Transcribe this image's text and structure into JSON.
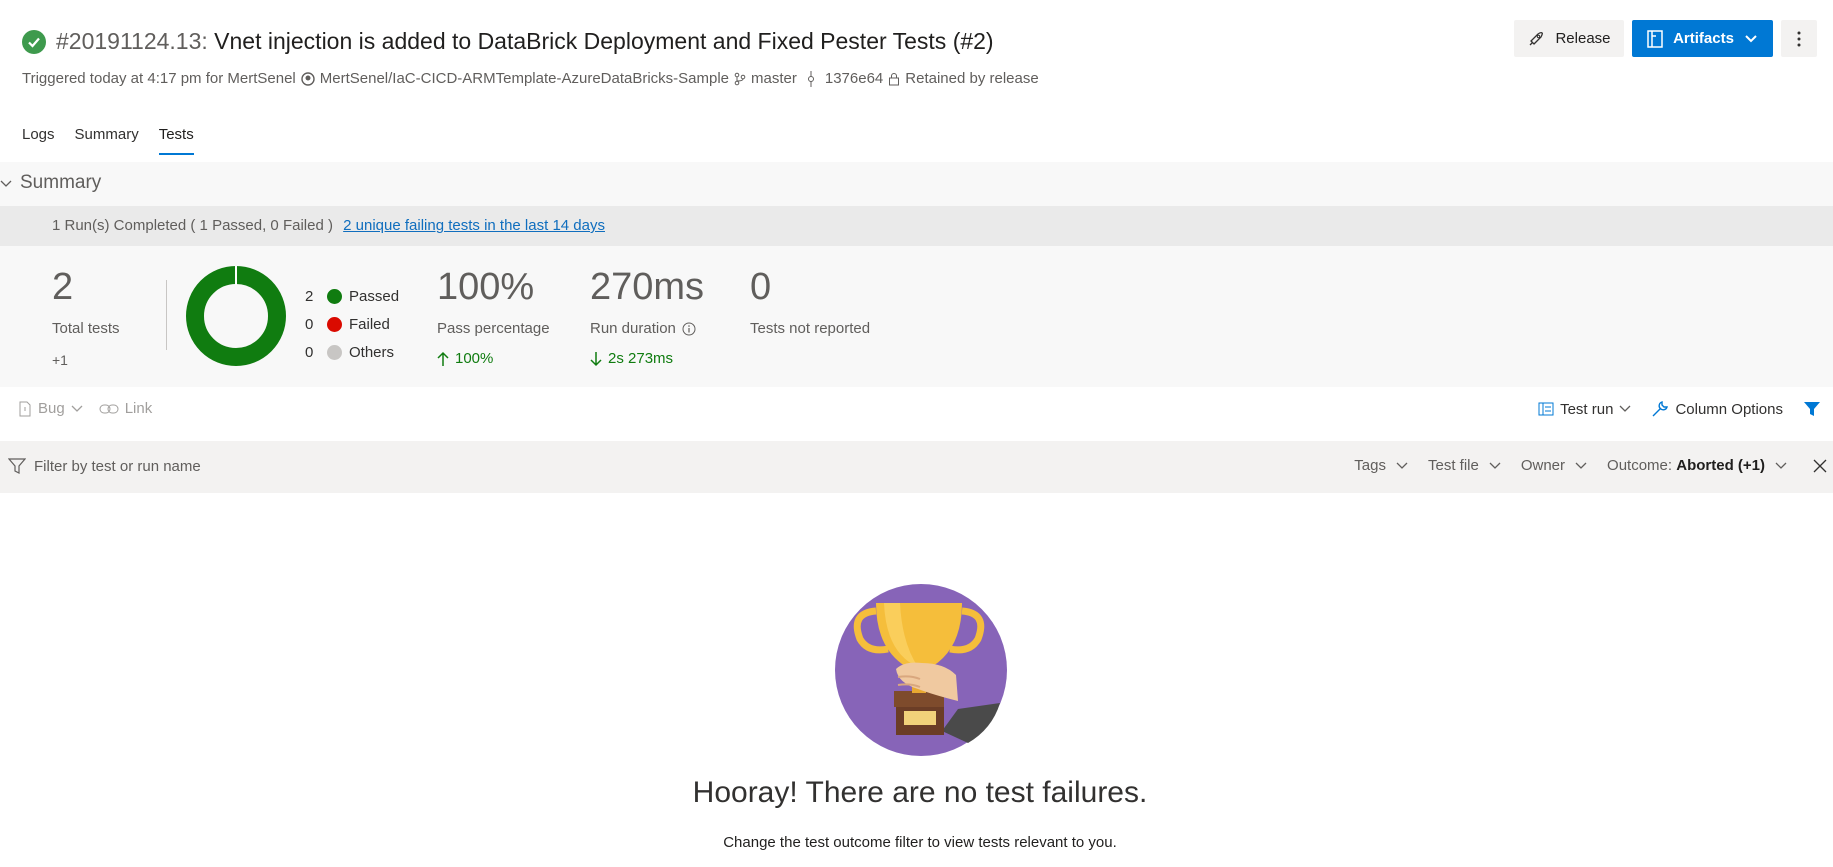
{
  "header": {
    "build_number": "#20191124.13:",
    "title": "Vnet injection is added to DataBrick Deployment and Fixed Pester Tests (#2)",
    "triggered": "Triggered today at 4:17 pm for MertSenel",
    "repo": "MertSenel/IaC-CICD-ARMTemplate-AzureDataBricks-Sample",
    "branch": "master",
    "commit": "1376e64",
    "retained": "Retained by release",
    "release_label": "Release",
    "artifacts_label": "Artifacts"
  },
  "tabs": [
    {
      "label": "Logs"
    },
    {
      "label": "Summary"
    },
    {
      "label": "Tests"
    }
  ],
  "summary": {
    "section_title": "Summary",
    "run_text": "1 Run(s) Completed ( 1 Passed, 0 Failed )",
    "run_link": "2 unique failing tests in the last 14 days",
    "total_tests": "2",
    "total_label": "Total tests",
    "total_delta": "+1",
    "legend": [
      {
        "count": "2",
        "label": "Passed",
        "color": "#107c10"
      },
      {
        "count": "0",
        "label": "Failed",
        "color": "#da0a00"
      },
      {
        "count": "0",
        "label": "Others",
        "color": "#c8c6c4"
      }
    ],
    "pass_pct": "100%",
    "pass_label": "Pass percentage",
    "pass_delta": "100%",
    "duration": "270ms",
    "duration_label": "Run duration",
    "duration_delta": "2s 273ms",
    "not_reported": "0",
    "not_reported_label": "Tests not reported"
  },
  "toolbar": {
    "bug": "Bug",
    "link": "Link",
    "test_run": "Test run",
    "column_options": "Column Options"
  },
  "filter": {
    "placeholder": "Filter by test or run name",
    "tags": "Tags",
    "test_file": "Test file",
    "owner": "Owner",
    "outcome_label": "Outcome:",
    "outcome_value": "Aborted (+1)"
  },
  "empty_state": {
    "title": "Hooray! There are no test failures.",
    "hint": "Change the test outcome filter to view tests relevant to you."
  },
  "colors": {
    "accent": "#0078d4",
    "success": "#107c10",
    "fail": "#da0a00",
    "trophy_bg": "#8764b8"
  }
}
